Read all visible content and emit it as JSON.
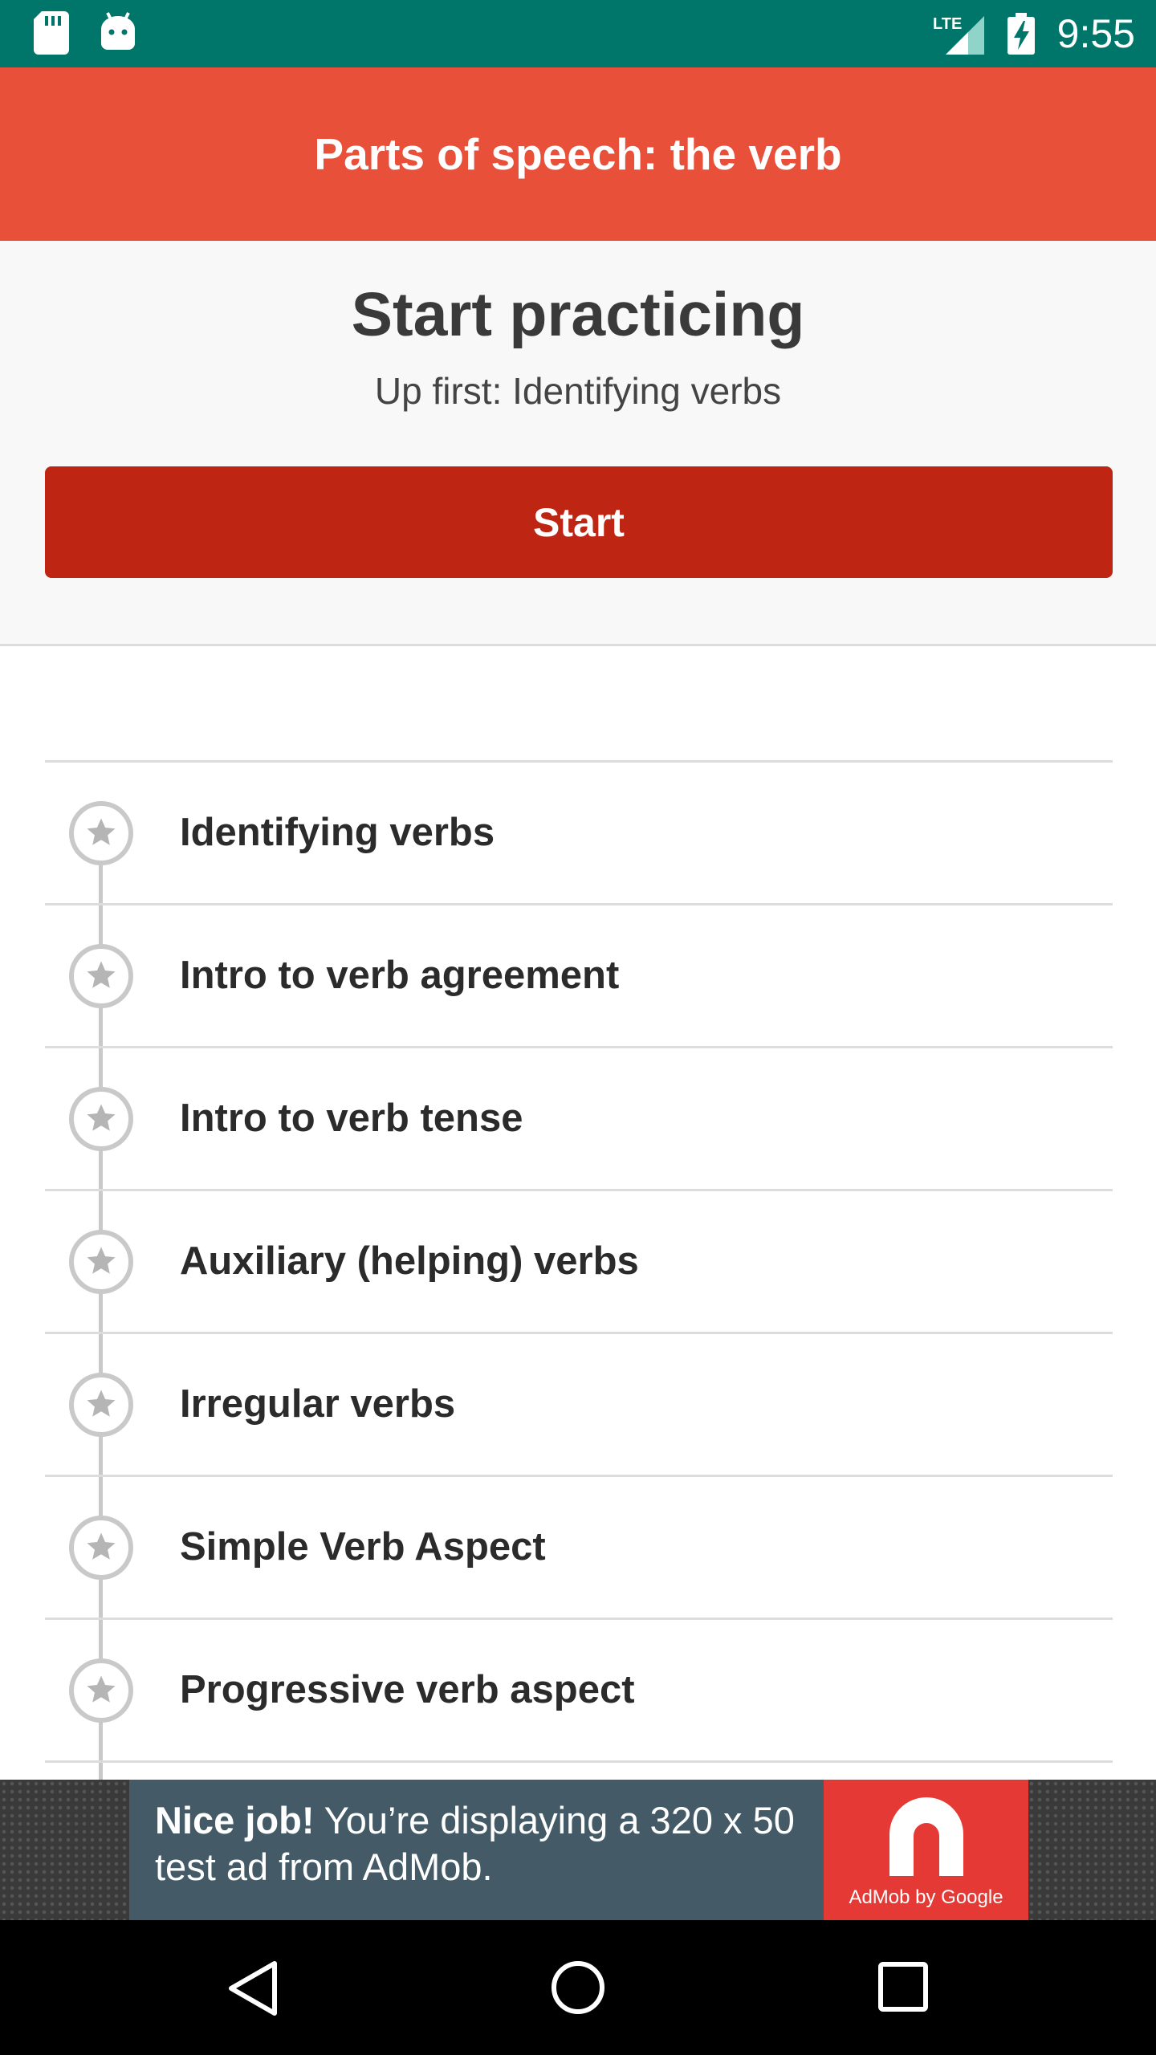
{
  "status_bar": {
    "time": "9:55",
    "network_label": "LTE",
    "icons": [
      "sd-card-icon",
      "android-icon",
      "lte-signal-icon",
      "battery-charging-icon"
    ]
  },
  "app_bar": {
    "title": "Parts of speech: the verb"
  },
  "header": {
    "title": "Start practicing",
    "subtitle": "Up first: Identifying verbs",
    "start_label": "Start"
  },
  "skills": [
    {
      "label": "Identifying verbs",
      "icon": "star-icon"
    },
    {
      "label": "Intro to verb agreement",
      "icon": "star-icon"
    },
    {
      "label": "Intro to verb tense",
      "icon": "star-icon"
    },
    {
      "label": "Auxiliary (helping) verbs",
      "icon": "star-icon"
    },
    {
      "label": "Irregular verbs",
      "icon": "star-icon"
    },
    {
      "label": "Simple Verb Aspect",
      "icon": "star-icon"
    },
    {
      "label": "Progressive verb aspect",
      "icon": "star-icon"
    }
  ],
  "ad": {
    "headline": "Nice job!",
    "body": " You’re displaying a 320 x 50 test ad from AdMob.",
    "brand": "AdMob by Google"
  },
  "nav_bar": {
    "icons": [
      "back-icon",
      "home-icon",
      "recents-icon"
    ]
  },
  "colors": {
    "status_bar": "#00766a",
    "app_bar": "#e8503a",
    "start_button": "#be2613",
    "ad_logo": "#e53935"
  }
}
